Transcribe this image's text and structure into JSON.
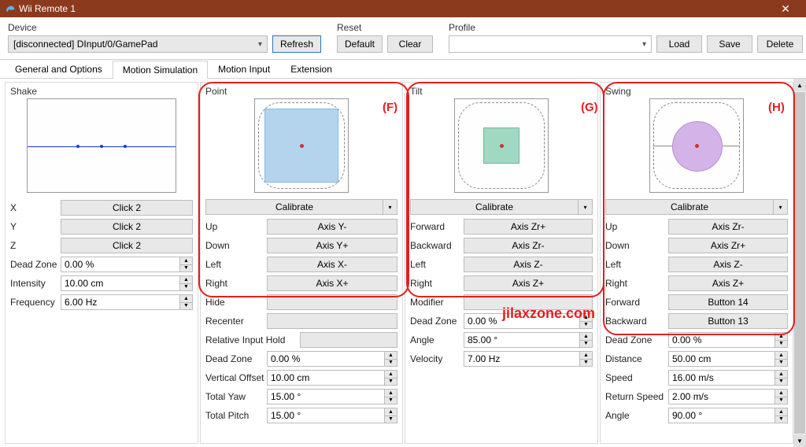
{
  "window": {
    "title": "Wii Remote 1",
    "close": "✕"
  },
  "device": {
    "label": "Device",
    "value": "[disconnected] DInput/0/GamePad",
    "refresh": "Refresh"
  },
  "reset": {
    "label": "Reset",
    "default": "Default",
    "clear": "Clear"
  },
  "profile": {
    "label": "Profile",
    "value": "",
    "load": "Load",
    "save": "Save",
    "delete": "Delete"
  },
  "tabs": [
    "General and Options",
    "Motion Simulation",
    "Motion Input",
    "Extension"
  ],
  "activeTab": 1,
  "shake": {
    "title": "Shake",
    "rows": [
      {
        "lbl": "X",
        "val": "Click 2",
        "type": "btn"
      },
      {
        "lbl": "Y",
        "val": "Click 2",
        "type": "btn"
      },
      {
        "lbl": "Z",
        "val": "Click 2",
        "type": "btn"
      },
      {
        "lbl": "Dead Zone",
        "val": "0.00 %",
        "type": "spin"
      },
      {
        "lbl": "Intensity",
        "val": "10.00 cm",
        "type": "spin"
      },
      {
        "lbl": "Frequency",
        "val": "6.00 Hz",
        "type": "spin"
      }
    ]
  },
  "point": {
    "title": "Point",
    "calib": "Calibrate",
    "rows": [
      {
        "lbl": "Up",
        "val": "Axis Y-",
        "type": "btn"
      },
      {
        "lbl": "Down",
        "val": "Axis Y+",
        "type": "btn"
      },
      {
        "lbl": "Left",
        "val": "Axis X-",
        "type": "btn"
      },
      {
        "lbl": "Right",
        "val": "Axis X+",
        "type": "btn"
      },
      {
        "lbl": "Hide",
        "val": "",
        "type": "btn"
      },
      {
        "lbl": "Recenter",
        "val": "",
        "type": "btn"
      },
      {
        "lbl": "Relative Input Hold",
        "val": "",
        "type": "btn",
        "wide": true
      },
      {
        "lbl": "Dead Zone",
        "val": "0.00 %",
        "type": "spin"
      },
      {
        "lbl": "Vertical Offset",
        "val": "10.00 cm",
        "type": "spin"
      },
      {
        "lbl": "Total Yaw",
        "val": "15.00 °",
        "type": "spin"
      },
      {
        "lbl": "Total Pitch",
        "val": "15.00 °",
        "type": "spin"
      }
    ]
  },
  "tilt": {
    "title": "Tilt",
    "calib": "Calibrate",
    "rows": [
      {
        "lbl": "Forward",
        "val": "Axis Zr+",
        "type": "btn"
      },
      {
        "lbl": "Backward",
        "val": "Axis Zr-",
        "type": "btn"
      },
      {
        "lbl": "Left",
        "val": "Axis Z-",
        "type": "btn"
      },
      {
        "lbl": "Right",
        "val": "Axis Z+",
        "type": "btn"
      },
      {
        "lbl": "Modifier",
        "val": "",
        "type": "btn"
      },
      {
        "lbl": "Dead Zone",
        "val": "0.00 %",
        "type": "spin"
      },
      {
        "lbl": "Angle",
        "val": "85.00 °",
        "type": "spin"
      },
      {
        "lbl": "Velocity",
        "val": "7.00 Hz",
        "type": "spin"
      }
    ]
  },
  "swing": {
    "title": "Swing",
    "calib": "Calibrate",
    "rows": [
      {
        "lbl": "Up",
        "val": "Axis Zr-",
        "type": "btn"
      },
      {
        "lbl": "Down",
        "val": "Axis Zr+",
        "type": "btn"
      },
      {
        "lbl": "Left",
        "val": "Axis Z-",
        "type": "btn"
      },
      {
        "lbl": "Right",
        "val": "Axis Z+",
        "type": "btn"
      },
      {
        "lbl": "Forward",
        "val": "Button 14",
        "type": "btn"
      },
      {
        "lbl": "Backward",
        "val": "Button 13",
        "type": "btn"
      },
      {
        "lbl": "Dead Zone",
        "val": "0.00 %",
        "type": "spin"
      },
      {
        "lbl": "Distance",
        "val": "50.00 cm",
        "type": "spin"
      },
      {
        "lbl": "Speed",
        "val": "16.00 m/s",
        "type": "spin"
      },
      {
        "lbl": "Return Speed",
        "val": "2.00 m/s",
        "type": "spin"
      },
      {
        "lbl": "Angle",
        "val": "90.00 °",
        "type": "spin"
      }
    ]
  },
  "anno": {
    "f": "(F)",
    "g": "(G)",
    "h": "(H)",
    "watermark": "jilaxzone.com"
  }
}
